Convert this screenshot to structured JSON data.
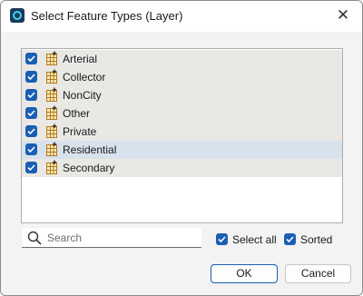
{
  "window": {
    "title": "Select Feature Types (Layer)",
    "close_glyph": "✕"
  },
  "layers": [
    {
      "label": "Arterial",
      "checked": true,
      "selected": false
    },
    {
      "label": "Collector",
      "checked": true,
      "selected": false
    },
    {
      "label": "NonCity",
      "checked": true,
      "selected": false
    },
    {
      "label": "Other",
      "checked": true,
      "selected": false
    },
    {
      "label": "Private",
      "checked": true,
      "selected": false
    },
    {
      "label": "Residential",
      "checked": true,
      "selected": true
    },
    {
      "label": "Secondary",
      "checked": true,
      "selected": false
    }
  ],
  "search": {
    "placeholder": "Search",
    "value": ""
  },
  "options": {
    "select_all": {
      "label": "Select all",
      "checked": true
    },
    "sorted": {
      "label": "Sorted",
      "checked": true
    }
  },
  "buttons": {
    "ok": "OK",
    "cancel": "Cancel"
  },
  "colors": {
    "accent": "#1a5fb4",
    "selected_row": "#d7e2ec",
    "row_bg": "#eae8e4"
  },
  "icons": {
    "app": "app-logo-icon",
    "layer": "feature-layer-icon",
    "search": "search-icon",
    "check": "checkmark-icon"
  }
}
